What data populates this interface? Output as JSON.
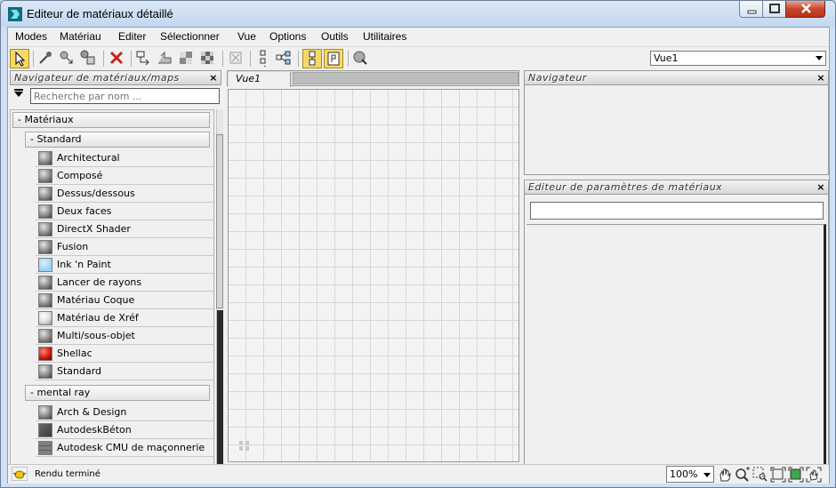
{
  "window": {
    "title": "Editeur de matériaux détaillé"
  },
  "menu": [
    "Modes",
    "Matériau",
    "Editer",
    "Sélectionner",
    "Vue",
    "Options",
    "Outils",
    "Utilitaires"
  ],
  "toolbar": {
    "view_select_value": "Vue1",
    "icons": [
      "select-arrow-icon",
      "eyedropper-icon",
      "put-to-scene-icon",
      "assign-material-icon",
      "delete-icon",
      "move-children-icon",
      "layout-icon",
      "background-checker-icon",
      "checker-pattern-icon",
      "hide-unused-icon",
      "vertical-layout-icon",
      "tree-layout-icon",
      "show-map-icon",
      "parameter-editor-icon",
      "render-preview-icon"
    ]
  },
  "browser": {
    "title": "Navigateur de matériaux/maps",
    "search_placeholder": "Recherche par nom ...",
    "groups": [
      {
        "label": "- Matériaux"
      },
      {
        "label": "- Standard"
      },
      {
        "label": "- mental ray"
      }
    ],
    "standard_items": [
      {
        "label": "Architectural",
        "swatch": "grey"
      },
      {
        "label": "Composé",
        "swatch": "grey"
      },
      {
        "label": "Dessus/dessous",
        "swatch": "grey"
      },
      {
        "label": "Deux faces",
        "swatch": "grey"
      },
      {
        "label": "DirectX Shader",
        "swatch": "grey"
      },
      {
        "label": "Fusion",
        "swatch": "grey"
      },
      {
        "label": "Ink 'n Paint",
        "swatch": "light-blue"
      },
      {
        "label": "Lancer de rayons",
        "swatch": "grey"
      },
      {
        "label": "Matériau Coque",
        "swatch": "grey"
      },
      {
        "label": "Matériau de Xréf",
        "swatch": "white"
      },
      {
        "label": "Multi/sous-objet",
        "swatch": "grey"
      },
      {
        "label": "Shellac",
        "swatch": "red"
      },
      {
        "label": "Standard",
        "swatch": "grey"
      }
    ],
    "mental_ray_items": [
      {
        "label": "Arch & Design",
        "swatch": "grey"
      },
      {
        "label": "AutodeskBéton",
        "swatch": "dark"
      },
      {
        "label": "Autodesk CMU de maçonnerie",
        "swatch": "masonry"
      }
    ]
  },
  "view_tab": {
    "label": "Vue1"
  },
  "navigator": {
    "title": "Navigateur"
  },
  "param_editor": {
    "title": "Editeur de paramètres de matériaux"
  },
  "status": {
    "text": "Rendu terminé",
    "zoom": "100%"
  },
  "colors": {
    "accent": "#f7d86a",
    "close_button": "#c9462c",
    "title_bar": "#cfe0f2"
  }
}
